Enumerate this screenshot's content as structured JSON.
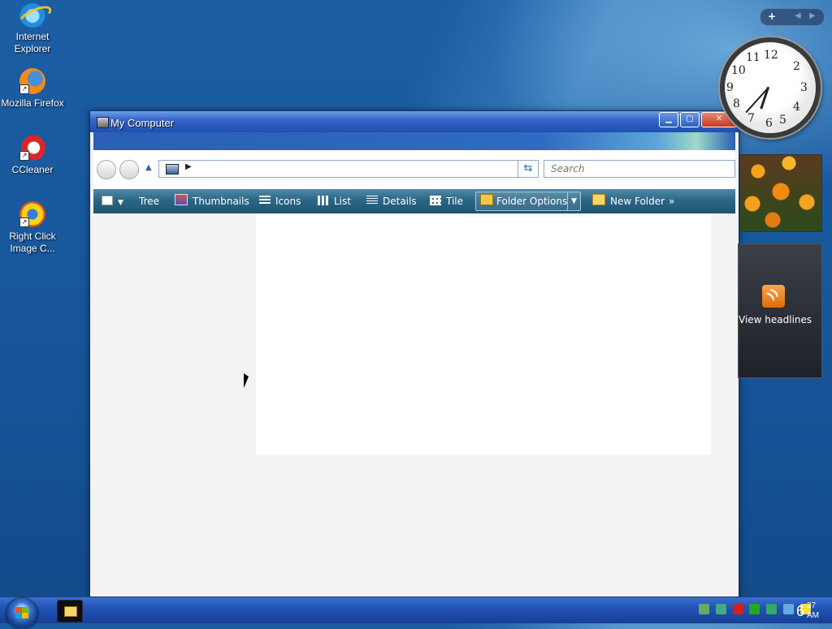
{
  "desktop": {
    "icons": [
      {
        "label": "Internet Explorer",
        "icon": "internet-explorer-icon"
      },
      {
        "label": "Mozilla Firefox",
        "icon": "firefox-icon"
      },
      {
        "label": "CCleaner",
        "icon": "ccleaner-icon"
      },
      {
        "label": "Right Click Image C...",
        "icon": "right-click-image-icon"
      }
    ]
  },
  "window": {
    "title": "My Computer",
    "buttons": {
      "minimize": "▁",
      "maximize": "▢",
      "close": "✕"
    },
    "search_placeholder": "Search",
    "toolbar": {
      "tree": "Tree",
      "thumbnails": "Thumbnails",
      "icons": "Icons",
      "list": "List",
      "details": "Details",
      "tile": "Tile",
      "folder_options": "Folder Options",
      "new_folder": "New Folder",
      "more": "»"
    }
  },
  "gadgets": {
    "clock": {
      "hour": 6,
      "minute": 37
    },
    "feeds_label": "View headlines"
  },
  "taskbar": {
    "clock_hour": "6",
    "clock_minute": "37",
    "clock_ampm": "AM"
  },
  "colors": {
    "desktop_blue": "#17579c",
    "taskbar_blue": "#2153b6",
    "title_blue": "#3467c7",
    "toolbar_teal": "#2c6686"
  }
}
